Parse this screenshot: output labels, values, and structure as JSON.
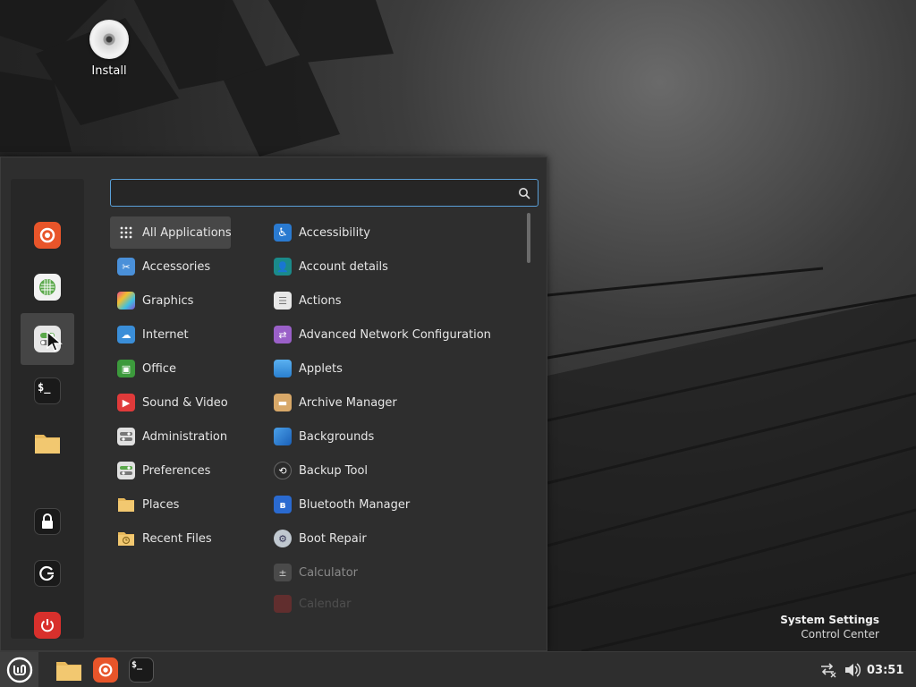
{
  "desktop": {
    "icons": [
      {
        "label": "Install",
        "icon": "disc-icon"
      }
    ]
  },
  "menu": {
    "search": {
      "value": "",
      "placeholder": ""
    },
    "favorites": [
      {
        "name": "firefox",
        "icon": "firefox-icon",
        "color": "#e8552a"
      },
      {
        "name": "software-manager",
        "icon": "software-manager-icon",
        "color": "#5aa84a"
      },
      {
        "name": "system-settings",
        "icon": "settings-toggle-icon",
        "color": "#e8e8e8"
      },
      {
        "name": "terminal",
        "icon": "terminal-icon",
        "color": "#1e1e1e"
      },
      {
        "name": "files",
        "icon": "folder-icon",
        "color": "#e8b95c"
      },
      {
        "name": "lock-screen",
        "icon": "lock-icon",
        "color": "#1e1e1e"
      },
      {
        "name": "logout",
        "icon": "logout-icon",
        "color": "#1e1e1e"
      },
      {
        "name": "shutdown",
        "icon": "power-icon",
        "color": "#d8302c"
      }
    ],
    "categories": [
      {
        "label": "All Applications",
        "icon": "grid-icon"
      },
      {
        "label": "Accessories",
        "icon": "scissors-icon"
      },
      {
        "label": "Graphics",
        "icon": "graphics-icon"
      },
      {
        "label": "Internet",
        "icon": "cloud-icon"
      },
      {
        "label": "Office",
        "icon": "office-icon"
      },
      {
        "label": "Sound & Video",
        "icon": "play-icon"
      },
      {
        "label": "Administration",
        "icon": "admin-icon"
      },
      {
        "label": "Preferences",
        "icon": "preferences-icon"
      },
      {
        "label": "Places",
        "icon": "folder-icon"
      },
      {
        "label": "Recent Files",
        "icon": "recent-folder-icon"
      }
    ],
    "apps": [
      {
        "label": "Accessibility",
        "icon": "accessibility-icon"
      },
      {
        "label": "Account details",
        "icon": "account-icon"
      },
      {
        "label": "Actions",
        "icon": "actions-icon"
      },
      {
        "label": "Advanced Network Configuration",
        "icon": "network-config-icon"
      },
      {
        "label": "Applets",
        "icon": "applets-icon"
      },
      {
        "label": "Archive Manager",
        "icon": "archive-icon"
      },
      {
        "label": "Backgrounds",
        "icon": "backgrounds-icon"
      },
      {
        "label": "Backup Tool",
        "icon": "backup-icon"
      },
      {
        "label": "Bluetooth Manager",
        "icon": "bluetooth-icon"
      },
      {
        "label": "Boot Repair",
        "icon": "boot-repair-icon"
      },
      {
        "label": "Calculator",
        "icon": "calculator-icon"
      },
      {
        "label": "Calendar",
        "icon": "calendar-icon"
      }
    ],
    "tooltip": {
      "title": "System Settings",
      "subtitle": "Control Center"
    }
  },
  "taskbar": {
    "pinned": [
      {
        "name": "files",
        "icon": "folder-icon"
      },
      {
        "name": "firefox",
        "icon": "firefox-icon"
      },
      {
        "name": "terminal",
        "icon": "terminal-icon"
      }
    ],
    "clock": "03:51"
  },
  "colors": {
    "accent": "#5aa0d8",
    "panel": "#2e2e2e"
  }
}
